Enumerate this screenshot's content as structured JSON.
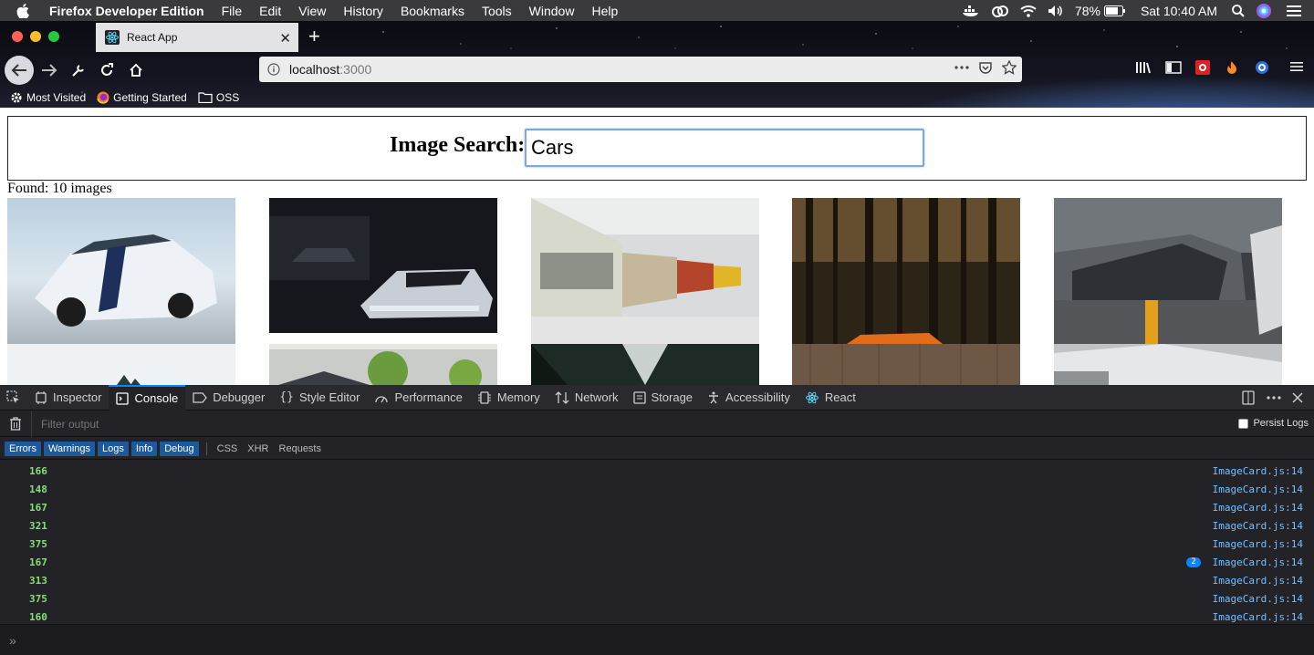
{
  "menubar": {
    "app_name": "Firefox Developer Edition",
    "items": [
      "File",
      "Edit",
      "View",
      "History",
      "Bookmarks",
      "Tools",
      "Window",
      "Help"
    ],
    "battery": "78%",
    "clock": "Sat 10:40 AM"
  },
  "tab": {
    "title": "React App"
  },
  "url": {
    "host": "localhost",
    "port": ":3000"
  },
  "bookmarks": [
    "Most Visited",
    "Getting Started",
    "OSS"
  ],
  "page": {
    "search_label": "Image Search:",
    "search_value": "Cars",
    "found_text": "Found: 10 images"
  },
  "devtools": {
    "tabs": [
      "Inspector",
      "Console",
      "Debugger",
      "Style Editor",
      "Performance",
      "Memory",
      "Network",
      "Storage",
      "Accessibility",
      "React"
    ],
    "active_tab": "Console",
    "filter_placeholder": "Filter output",
    "persist_label": "Persist Logs",
    "levels": [
      "Errors",
      "Warnings",
      "Logs",
      "Info",
      "Debug"
    ],
    "filters": [
      "CSS",
      "XHR",
      "Requests"
    ],
    "console_rows": [
      {
        "value": "166",
        "source": "ImageCard.js:14",
        "badge": ""
      },
      {
        "value": "148",
        "source": "ImageCard.js:14",
        "badge": ""
      },
      {
        "value": "167",
        "source": "ImageCard.js:14",
        "badge": ""
      },
      {
        "value": "321",
        "source": "ImageCard.js:14",
        "badge": ""
      },
      {
        "value": "375",
        "source": "ImageCard.js:14",
        "badge": ""
      },
      {
        "value": "167",
        "source": "ImageCard.js:14",
        "badge": "2"
      },
      {
        "value": "313",
        "source": "ImageCard.js:14",
        "badge": ""
      },
      {
        "value": "375",
        "source": "ImageCard.js:14",
        "badge": ""
      },
      {
        "value": "160",
        "source": "ImageCard.js:14",
        "badge": ""
      }
    ]
  },
  "colors": {
    "accent": "#0a84ff",
    "console_value": "#86de74",
    "console_source": "#75bfff"
  }
}
